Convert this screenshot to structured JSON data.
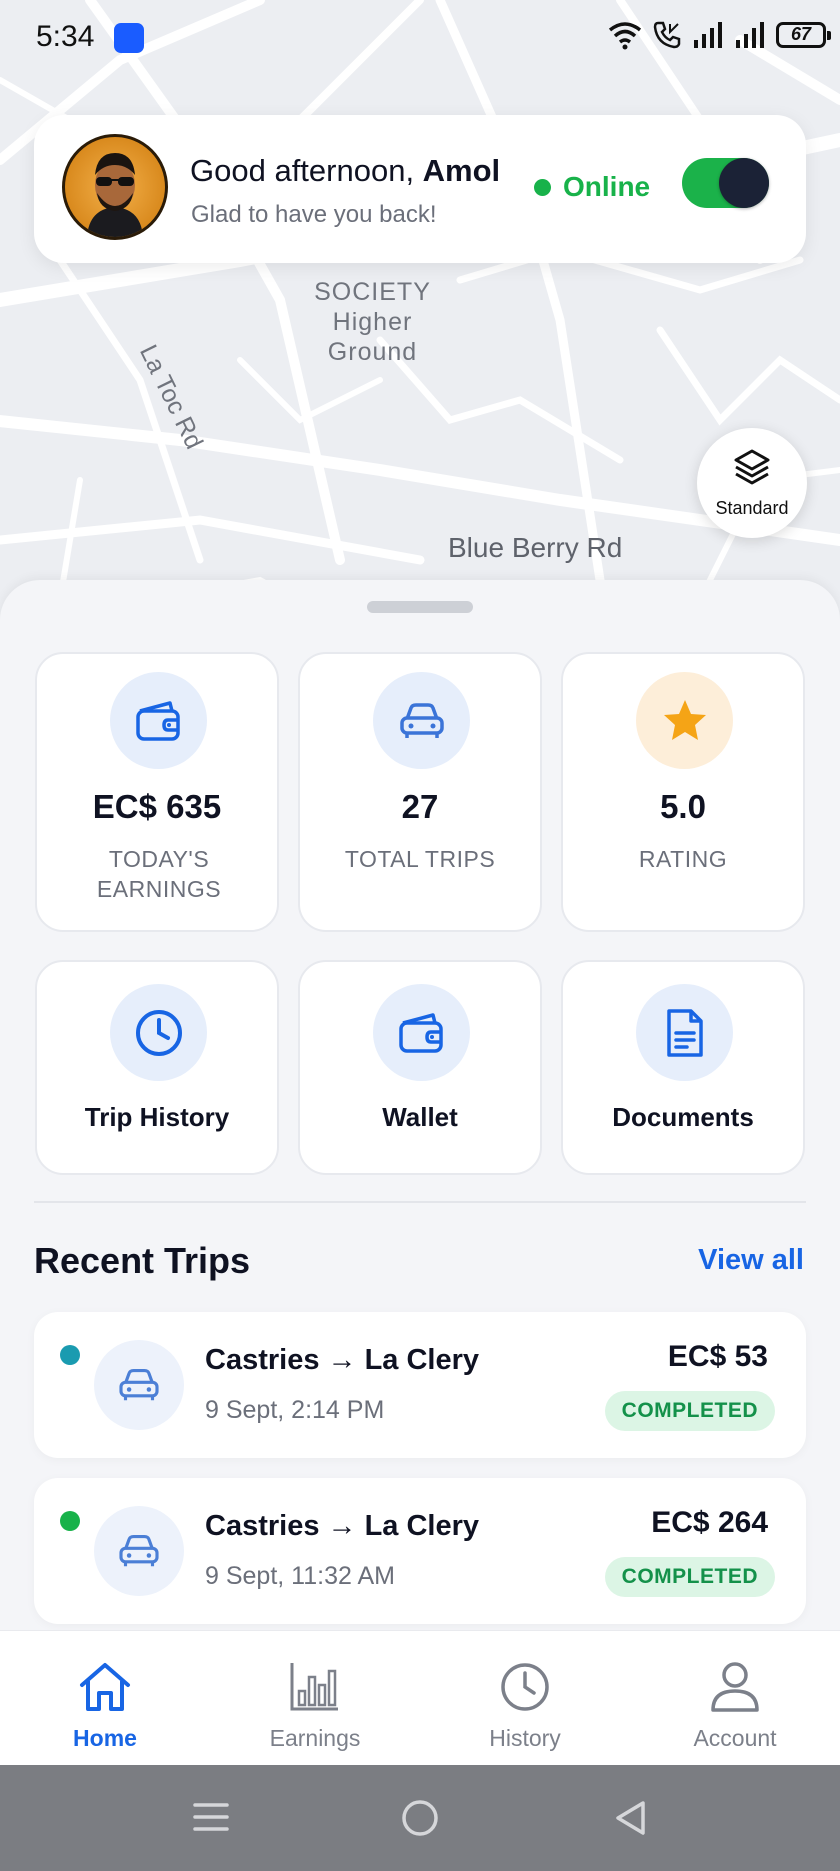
{
  "status_bar": {
    "time": "5:34",
    "battery": "67"
  },
  "map": {
    "labels": {
      "society": [
        "SOCIETY",
        "Higher",
        "Ground"
      ],
      "road_1": "La Toc Rd",
      "road_2": "Blue Berry Rd"
    },
    "style_button": "Standard"
  },
  "greeting": {
    "salutation": "Good afternoon, ",
    "name": "Amol",
    "subtitle": "Glad to have you back!",
    "status_label": "Online",
    "online": true
  },
  "stats": [
    {
      "value": "EC$ 635",
      "label": "TODAY'S EARNINGS",
      "icon": "wallet-icon"
    },
    {
      "value": "27",
      "label": "TOTAL TRIPS",
      "icon": "car-icon"
    },
    {
      "value": "5.0",
      "label": "RATING",
      "icon": "star-icon"
    }
  ],
  "actions": [
    {
      "label": "Trip History",
      "icon": "clock-icon"
    },
    {
      "label": "Wallet",
      "icon": "wallet-icon"
    },
    {
      "label": "Documents",
      "icon": "document-icon"
    }
  ],
  "recent_trips": {
    "title": "Recent Trips",
    "view_all": "View all",
    "items": [
      {
        "route": "Castries → La Clery",
        "time": "9 Sept, 2:14 PM",
        "amount": "EC$ 53",
        "status": "COMPLETED",
        "dot_color": "#1a9bb0"
      },
      {
        "route": "Castries → La Clery",
        "time": "9 Sept, 11:32 AM",
        "amount": "EC$ 264",
        "status": "COMPLETED",
        "dot_color": "#18b24a"
      }
    ]
  },
  "bottom_nav": [
    {
      "label": "Home",
      "icon": "home-icon",
      "active": true
    },
    {
      "label": "Earnings",
      "icon": "bar-chart-icon",
      "active": false
    },
    {
      "label": "History",
      "icon": "clock-icon",
      "active": false
    },
    {
      "label": "Account",
      "icon": "user-icon",
      "active": false
    }
  ],
  "colors": {
    "accent": "#1865e4",
    "online": "#18b24a",
    "star": "#f5a416"
  }
}
